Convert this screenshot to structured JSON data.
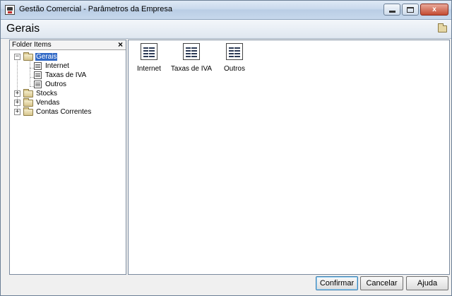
{
  "window": {
    "title": "Gestão Comercial - Parâmetros da Empresa",
    "close_glyph": "x"
  },
  "header": {
    "title": "Gerais"
  },
  "folder_panel": {
    "title": "Folder Items",
    "close_glyph": "×",
    "tree": {
      "gerais": {
        "label": "Gerais",
        "expander": "−",
        "selected": true
      },
      "gerais_children": [
        "Internet",
        "Taxas de IVA",
        "Outros"
      ],
      "stocks": {
        "label": "Stocks",
        "expander": "+"
      },
      "vendas": {
        "label": "Vendas",
        "expander": "+"
      },
      "contas_correntes": {
        "label": "Contas Correntes",
        "expander": "+"
      }
    }
  },
  "content": {
    "items": [
      {
        "label": "Internet",
        "icon": "list-page-icon"
      },
      {
        "label": "Taxas de IVA",
        "icon": "list-page-icon"
      },
      {
        "label": "Outros",
        "icon": "list-page-icon"
      }
    ]
  },
  "footer": {
    "confirm_label": "Confirmar",
    "cancel_label": "Cancelar",
    "help_label": "Ajuda"
  },
  "colors": {
    "selection": "#3169c6",
    "titlebar": "#c9d9ec"
  }
}
